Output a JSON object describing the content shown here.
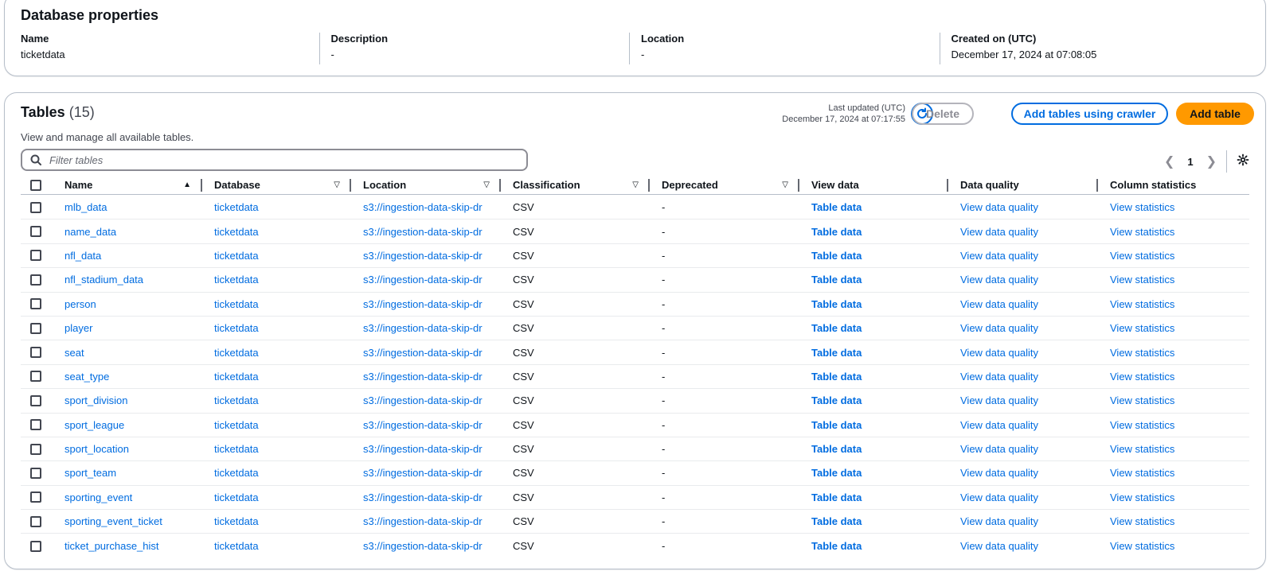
{
  "properties": {
    "title": "Database properties",
    "fields": [
      {
        "label": "Name",
        "value": "ticketdata"
      },
      {
        "label": "Description",
        "value": "-"
      },
      {
        "label": "Location",
        "value": "-"
      },
      {
        "label": "Created on (UTC)",
        "value": "December 17, 2024 at 07:08:05"
      }
    ]
  },
  "tables": {
    "title": "Tables",
    "count": "(15)",
    "description": "View and manage all available tables.",
    "last_updated_label": "Last updated (UTC)",
    "last_updated_value": "December 17, 2024 at 07:17:55",
    "delete_label": "Delete",
    "add_crawler_label": "Add tables using crawler",
    "add_table_label": "Add table",
    "filter_placeholder": "Filter tables",
    "page": "1",
    "columns": [
      "Name",
      "Database",
      "Location",
      "Classification",
      "Deprecated",
      "View data",
      "Data quality",
      "Column statistics"
    ],
    "rows": [
      {
        "name": "mlb_data",
        "database": "ticketdata",
        "location": "s3://ingestion-data-skip-dr",
        "classification": "CSV",
        "deprecated": "-",
        "view_data": "Table data",
        "data_quality": "View data quality",
        "column_statistics": "View statistics"
      },
      {
        "name": "name_data",
        "database": "ticketdata",
        "location": "s3://ingestion-data-skip-dr",
        "classification": "CSV",
        "deprecated": "-",
        "view_data": "Table data",
        "data_quality": "View data quality",
        "column_statistics": "View statistics"
      },
      {
        "name": "nfl_data",
        "database": "ticketdata",
        "location": "s3://ingestion-data-skip-dr",
        "classification": "CSV",
        "deprecated": "-",
        "view_data": "Table data",
        "data_quality": "View data quality",
        "column_statistics": "View statistics"
      },
      {
        "name": "nfl_stadium_data",
        "database": "ticketdata",
        "location": "s3://ingestion-data-skip-dr",
        "classification": "CSV",
        "deprecated": "-",
        "view_data": "Table data",
        "data_quality": "View data quality",
        "column_statistics": "View statistics"
      },
      {
        "name": "person",
        "database": "ticketdata",
        "location": "s3://ingestion-data-skip-dr",
        "classification": "CSV",
        "deprecated": "-",
        "view_data": "Table data",
        "data_quality": "View data quality",
        "column_statistics": "View statistics"
      },
      {
        "name": "player",
        "database": "ticketdata",
        "location": "s3://ingestion-data-skip-dr",
        "classification": "CSV",
        "deprecated": "-",
        "view_data": "Table data",
        "data_quality": "View data quality",
        "column_statistics": "View statistics"
      },
      {
        "name": "seat",
        "database": "ticketdata",
        "location": "s3://ingestion-data-skip-dr",
        "classification": "CSV",
        "deprecated": "-",
        "view_data": "Table data",
        "data_quality": "View data quality",
        "column_statistics": "View statistics"
      },
      {
        "name": "seat_type",
        "database": "ticketdata",
        "location": "s3://ingestion-data-skip-dr",
        "classification": "CSV",
        "deprecated": "-",
        "view_data": "Table data",
        "data_quality": "View data quality",
        "column_statistics": "View statistics"
      },
      {
        "name": "sport_division",
        "database": "ticketdata",
        "location": "s3://ingestion-data-skip-dr",
        "classification": "CSV",
        "deprecated": "-",
        "view_data": "Table data",
        "data_quality": "View data quality",
        "column_statistics": "View statistics"
      },
      {
        "name": "sport_league",
        "database": "ticketdata",
        "location": "s3://ingestion-data-skip-dr",
        "classification": "CSV",
        "deprecated": "-",
        "view_data": "Table data",
        "data_quality": "View data quality",
        "column_statistics": "View statistics"
      },
      {
        "name": "sport_location",
        "database": "ticketdata",
        "location": "s3://ingestion-data-skip-dr",
        "classification": "CSV",
        "deprecated": "-",
        "view_data": "Table data",
        "data_quality": "View data quality",
        "column_statistics": "View statistics"
      },
      {
        "name": "sport_team",
        "database": "ticketdata",
        "location": "s3://ingestion-data-skip-dr",
        "classification": "CSV",
        "deprecated": "-",
        "view_data": "Table data",
        "data_quality": "View data quality",
        "column_statistics": "View statistics"
      },
      {
        "name": "sporting_event",
        "database": "ticketdata",
        "location": "s3://ingestion-data-skip-dr",
        "classification": "CSV",
        "deprecated": "-",
        "view_data": "Table data",
        "data_quality": "View data quality",
        "column_statistics": "View statistics"
      },
      {
        "name": "sporting_event_ticket",
        "database": "ticketdata",
        "location": "s3://ingestion-data-skip-dr",
        "classification": "CSV",
        "deprecated": "-",
        "view_data": "Table data",
        "data_quality": "View data quality",
        "column_statistics": "View statistics"
      },
      {
        "name": "ticket_purchase_hist",
        "database": "ticketdata",
        "location": "s3://ingestion-data-skip-dr",
        "classification": "CSV",
        "deprecated": "-",
        "view_data": "Table data",
        "data_quality": "View data quality",
        "column_statistics": "View statistics"
      }
    ]
  },
  "icons": {
    "refresh": "refresh-icon",
    "search": "search-icon",
    "prev": "chevron-left-icon",
    "next": "chevron-right-icon",
    "settings": "gear-icon",
    "sort_asc": "caret-up-icon",
    "sort_none": "caret-down-outline-icon"
  },
  "colors": {
    "link": "#006ce0",
    "primary_button": "#ff9900",
    "border": "#b6bec9"
  }
}
